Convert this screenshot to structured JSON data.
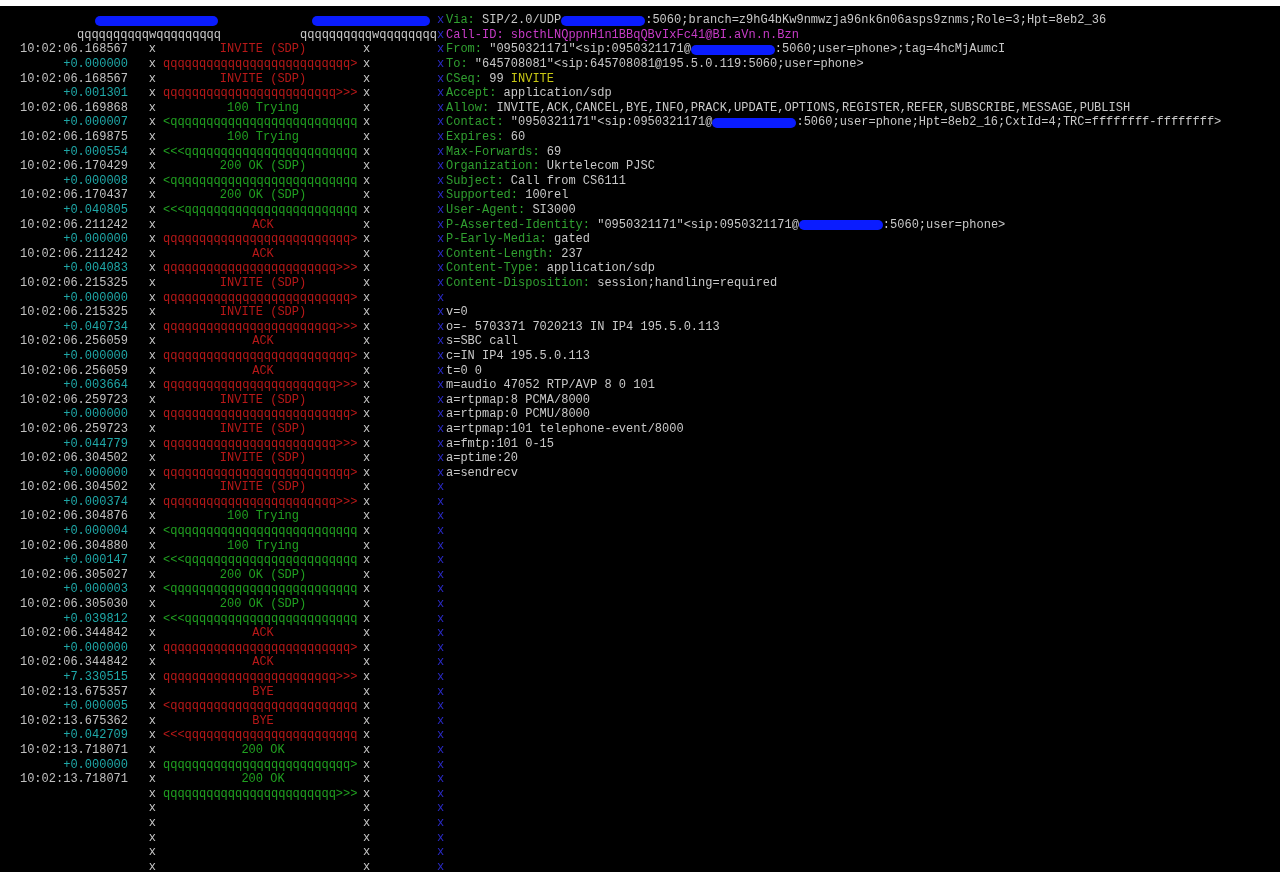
{
  "flow": {
    "header_rules": [
      "qqqqqqqqqqwqqqqqqqqq",
      "qqqqqqqqqqwqqqqqqqq"
    ],
    "messages": [
      {
        "time": "10:02:06.168567",
        "label": "INVITE (SDP)",
        "delta": "+0.000000",
        "arrow": "qqqqqqqqqqqqqqqqqqqqqqqqqq>",
        "kind": "request",
        "markers": [
          "x",
          "x",
          "x",
          "x"
        ]
      },
      {
        "time": "10:02:06.168567",
        "label": "INVITE (SDP)",
        "delta": "+0.001301",
        "arrow": "qqqqqqqqqqqqqqqqqqqqqqqq>>>",
        "kind": "request",
        "markers": [
          "x",
          "x",
          "x",
          "x"
        ]
      },
      {
        "time": "10:02:06.169868",
        "label": "100 Trying",
        "delta": "+0.000007",
        "arrow": "<qqqqqqqqqqqqqqqqqqqqqqqqqq",
        "kind": "response",
        "markers": [
          "x",
          "x",
          "x",
          "x"
        ]
      },
      {
        "time": "10:02:06.169875",
        "label": "100 Trying",
        "delta": "+0.000554",
        "arrow": "<<<qqqqqqqqqqqqqqqqqqqqqqqq",
        "kind": "response",
        "markers": [
          "x",
          "x",
          "x",
          "x"
        ]
      },
      {
        "time": "10:02:06.170429",
        "label": "200 OK (SDP)",
        "delta": "+0.000008",
        "arrow": "<qqqqqqqqqqqqqqqqqqqqqqqqqq",
        "kind": "response",
        "markers": [
          "x",
          "x",
          "x",
          "x"
        ]
      },
      {
        "time": "10:02:06.170437",
        "label": "200 OK (SDP)",
        "delta": "+0.040805",
        "arrow": "<<<qqqqqqqqqqqqqqqqqqqqqqqq",
        "kind": "response",
        "markers": [
          "x",
          "x",
          "x",
          "x"
        ]
      },
      {
        "time": "10:02:06.211242",
        "label": "ACK",
        "delta": "+0.000000",
        "arrow": "qqqqqqqqqqqqqqqqqqqqqqqqqq>",
        "kind": "request",
        "markers": [
          "x",
          "x",
          "x",
          "x"
        ]
      },
      {
        "time": "10:02:06.211242",
        "label": "ACK",
        "delta": "+0.004083",
        "arrow": "qqqqqqqqqqqqqqqqqqqqqqqq>>>",
        "kind": "request",
        "markers": [
          "x",
          "x",
          "x",
          "x"
        ]
      },
      {
        "time": "10:02:06.215325",
        "label": "INVITE (SDP)",
        "delta": "+0.000000",
        "arrow": "qqqqqqqqqqqqqqqqqqqqqqqqqq>",
        "kind": "request",
        "markers": [
          "x",
          "x",
          "x",
          "x"
        ]
      },
      {
        "time": "10:02:06.215325",
        "label": "INVITE (SDP)",
        "delta": "+0.040734",
        "arrow": "qqqqqqqqqqqqqqqqqqqqqqqq>>>",
        "kind": "request",
        "markers": [
          "x",
          "x",
          "x",
          "x"
        ]
      },
      {
        "time": "10:02:06.256059",
        "label": "ACK",
        "delta": "+0.000000",
        "arrow": "qqqqqqqqqqqqqqqqqqqqqqqqqq>",
        "kind": "request",
        "markers": [
          "x",
          "x",
          "x",
          "x"
        ]
      },
      {
        "time": "10:02:06.256059",
        "label": "ACK",
        "delta": "+0.003664",
        "arrow": "qqqqqqqqqqqqqqqqqqqqqqqq>>>",
        "kind": "request",
        "markers": [
          "x",
          "x",
          "x",
          "x"
        ]
      },
      {
        "time": "10:02:06.259723",
        "label": "INVITE (SDP)",
        "delta": "+0.000000",
        "arrow": "qqqqqqqqqqqqqqqqqqqqqqqqqq>",
        "kind": "request",
        "markers": [
          "x",
          "x",
          "x",
          "x"
        ]
      },
      {
        "time": "10:02:06.259723",
        "label": "INVITE (SDP)",
        "delta": "+0.044779",
        "arrow": "qqqqqqqqqqqqqqqqqqqqqqqq>>>",
        "kind": "request",
        "markers": [
          "x",
          "x",
          "x",
          "x"
        ]
      },
      {
        "time": "10:02:06.304502",
        "label": "INVITE (SDP)",
        "delta": "+0.000000",
        "arrow": "qqqqqqqqqqqqqqqqqqqqqqqqqq>",
        "kind": "request",
        "markers": [
          "x",
          "x",
          "x",
          "x"
        ]
      },
      {
        "time": "10:02:06.304502",
        "label": "INVITE (SDP)",
        "delta": "+0.000374",
        "arrow": "qqqqqqqqqqqqqqqqqqqqqqqq>>>",
        "kind": "request",
        "markers": [
          "x",
          "x",
          "x",
          "x"
        ]
      },
      {
        "time": "10:02:06.304876",
        "label": "100 Trying",
        "delta": "+0.000004",
        "arrow": "<qqqqqqqqqqqqqqqqqqqqqqqqqq",
        "kind": "response",
        "markers": [
          "x",
          "x",
          "x",
          "x"
        ]
      },
      {
        "time": "10:02:06.304880",
        "label": "100 Trying",
        "delta": "+0.000147",
        "arrow": "<<<qqqqqqqqqqqqqqqqqqqqqqqq",
        "kind": "response",
        "markers": [
          "x",
          "x",
          "x",
          "x"
        ]
      },
      {
        "time": "10:02:06.305027",
        "label": "200 OK (SDP)",
        "delta": "+0.000003",
        "arrow": "<qqqqqqqqqqqqqqqqqqqqqqqqqq",
        "kind": "response",
        "markers": [
          "x",
          "x",
          "x",
          "x"
        ]
      },
      {
        "time": "10:02:06.305030",
        "label": "200 OK (SDP)",
        "delta": "+0.039812",
        "arrow": "<<<qqqqqqqqqqqqqqqqqqqqqqqq",
        "kind": "response",
        "markers": [
          "x",
          "x",
          "x",
          "x"
        ]
      },
      {
        "time": "10:02:06.344842",
        "label": "ACK",
        "delta": "+0.000000",
        "arrow": "qqqqqqqqqqqqqqqqqqqqqqqqqq>",
        "kind": "request",
        "markers": [
          "x",
          "x",
          "x",
          "x"
        ]
      },
      {
        "time": "10:02:06.344842",
        "label": "ACK",
        "delta": "+7.330515",
        "arrow": "qqqqqqqqqqqqqqqqqqqqqqqq>>>",
        "kind": "request",
        "markers": [
          "x",
          "x",
          "x",
          "x"
        ]
      },
      {
        "time": "10:02:13.675357",
        "label": "BYE",
        "delta": "+0.000005",
        "arrow": "<qqqqqqqqqqqqqqqqqqqqqqqqqq",
        "kind": "request",
        "markers": [
          "x",
          "x",
          "x",
          "x"
        ]
      },
      {
        "time": "10:02:13.675362",
        "label": "BYE",
        "delta": "+0.042709",
        "arrow": "<<<qqqqqqqqqqqqqqqqqqqqqqqq",
        "kind": "request",
        "markers": [
          "x",
          "x",
          "x",
          "x"
        ]
      },
      {
        "time": "10:02:13.718071",
        "label": "200 OK",
        "delta": "+0.000000",
        "arrow": "qqqqqqqqqqqqqqqqqqqqqqqqqq>",
        "kind": "response",
        "markers": [
          "x",
          "x",
          "x",
          "x"
        ]
      },
      {
        "time": "10:02:13.718071",
        "label": "200 OK",
        "arrow": "qqqqqqqqqqqqqqqqqqqqqqqq>>>",
        "kind": "response",
        "markers": [
          "x",
          "x",
          "x",
          "x"
        ]
      }
    ],
    "blank_rows": [
      [
        "x",
        "x"
      ],
      [
        "x",
        "x"
      ],
      [
        "x",
        "x"
      ],
      [
        "x",
        "x"
      ],
      [
        "x",
        "x"
      ]
    ]
  },
  "detail": {
    "lines": [
      {
        "kind": "header",
        "marker": "x",
        "name": "Via:",
        "segments": [
          {
            "kind": "text",
            "text": "SIP/2.0/UDP"
          },
          {
            "kind": "redaction"
          },
          {
            "kind": "text",
            "text": ":5060;branch=z9hG4bKw9nmwzja96nk6n06asps9znms;Role=3;Hpt=8eb2_36"
          }
        ]
      },
      {
        "kind": "id_header",
        "marker": "x",
        "name": "Call-ID:",
        "segments": [
          {
            "kind": "text",
            "text": "sbcthLNQppnH1n1BBqQBvIxFc41@BI.aVn.n.Bzn"
          }
        ]
      },
      {
        "kind": "header",
        "marker": "x",
        "name": "From:",
        "segments": [
          {
            "kind": "text",
            "text": "\"0950321171\"<sip:0950321171@"
          },
          {
            "kind": "redaction"
          },
          {
            "kind": "text",
            "text": ":5060;user=phone>;tag=4hcMjAumcI"
          }
        ]
      },
      {
        "kind": "header",
        "marker": "x",
        "name": "To:",
        "segments": [
          {
            "kind": "text",
            "text": "\"645708081\"<sip:645708081@195.5.0.119:5060;user=phone>"
          }
        ]
      },
      {
        "kind": "header",
        "marker": "x",
        "name": "CSeq:",
        "segments": [
          {
            "kind": "text",
            "text": "99"
          },
          {
            "kind": "method",
            "text": "INVITE"
          }
        ]
      },
      {
        "kind": "header",
        "marker": "x",
        "name": "Accept:",
        "segments": [
          {
            "kind": "text",
            "text": "application/sdp"
          }
        ]
      },
      {
        "kind": "header",
        "marker": "x",
        "name": "Allow:",
        "segments": [
          {
            "kind": "text",
            "text": "INVITE,ACK,CANCEL,BYE,INFO,PRACK,UPDATE,OPTIONS,REGISTER,REFER,SUBSCRIBE,MESSAGE,PUBLISH"
          }
        ]
      },
      {
        "kind": "header",
        "marker": "x",
        "name": "Contact:",
        "segments": [
          {
            "kind": "text",
            "text": "\"0950321171\"<sip:0950321171@"
          },
          {
            "kind": "redaction"
          },
          {
            "kind": "text",
            "text": ":5060;user=phone;Hpt=8eb2_16;CxtId=4;TRC=ffffffff-ffffffff>"
          }
        ]
      },
      {
        "kind": "header",
        "marker": "x",
        "name": "Expires:",
        "segments": [
          {
            "kind": "text",
            "text": "60"
          }
        ]
      },
      {
        "kind": "header",
        "marker": "x",
        "name": "Max-Forwards:",
        "segments": [
          {
            "kind": "text",
            "text": "69"
          }
        ]
      },
      {
        "kind": "header",
        "marker": "x",
        "name": "Organization:",
        "segments": [
          {
            "kind": "text",
            "text": "Ukrtelecom PJSC"
          }
        ]
      },
      {
        "kind": "header",
        "marker": "x",
        "name": "Subject:",
        "segments": [
          {
            "kind": "text",
            "text": "Call from CS6111"
          }
        ]
      },
      {
        "kind": "header",
        "marker": "x",
        "name": "Supported:",
        "segments": [
          {
            "kind": "text",
            "text": "100rel"
          }
        ]
      },
      {
        "kind": "header",
        "marker": "x",
        "name": "User-Agent:",
        "segments": [
          {
            "kind": "text",
            "text": "SI3000"
          }
        ]
      },
      {
        "kind": "header",
        "marker": "x",
        "name": "P-Asserted-Identity:",
        "segments": [
          {
            "kind": "text",
            "text": "\"0950321171\"<sip:0950321171@"
          },
          {
            "kind": "redaction"
          },
          {
            "kind": "text",
            "text": ":5060;user=phone>"
          }
        ]
      },
      {
        "kind": "header",
        "marker": "x",
        "name": "P-Early-Media:",
        "segments": [
          {
            "kind": "text",
            "text": "gated"
          }
        ]
      },
      {
        "kind": "header",
        "marker": "x",
        "name": "Content-Length:",
        "segments": [
          {
            "kind": "text",
            "text": "237"
          }
        ]
      },
      {
        "kind": "header",
        "marker": "x",
        "name": "Content-Type:",
        "segments": [
          {
            "kind": "text",
            "text": "application/sdp"
          }
        ]
      },
      {
        "kind": "header",
        "marker": "x",
        "name": "Content-Disposition:",
        "segments": [
          {
            "kind": "text",
            "text": "session;handling=required"
          }
        ]
      },
      {
        "kind": "blank",
        "marker": "x"
      },
      {
        "kind": "sdp",
        "marker": "x",
        "text": "v=0"
      },
      {
        "kind": "sdp",
        "marker": "x",
        "text": "o=- 5703371 7020213 IN IP4 195.5.0.113"
      },
      {
        "kind": "sdp",
        "marker": "x",
        "text": "s=SBC call"
      },
      {
        "kind": "sdp",
        "marker": "x",
        "text": "c=IN IP4 195.5.0.113"
      },
      {
        "kind": "sdp",
        "marker": "x",
        "text": "t=0 0"
      },
      {
        "kind": "sdp",
        "marker": "x",
        "text": "m=audio 47052 RTP/AVP 8 0 101"
      },
      {
        "kind": "sdp",
        "marker": "x",
        "text": "a=rtpmap:8 PCMA/8000"
      },
      {
        "kind": "sdp",
        "marker": "x",
        "text": "a=rtpmap:0 PCMU/8000"
      },
      {
        "kind": "sdp",
        "marker": "x",
        "text": "a=rtpmap:101 telephone-event/8000"
      },
      {
        "kind": "sdp",
        "marker": "x",
        "text": "a=fmtp:101 0-15"
      },
      {
        "kind": "sdp",
        "marker": "x",
        "text": "a=ptime:20"
      },
      {
        "kind": "sdp",
        "marker": "x",
        "text": "a=sendrecv"
      }
    ],
    "blank_lines": [
      "x",
      "x",
      "x",
      "x",
      "x",
      "x",
      "x",
      "x",
      "x",
      "x",
      "x",
      "x",
      "x",
      "x",
      "x",
      "x",
      "x",
      "x",
      "x",
      "x",
      "x",
      "x",
      "x",
      "x",
      "x",
      "x",
      "x"
    ]
  }
}
